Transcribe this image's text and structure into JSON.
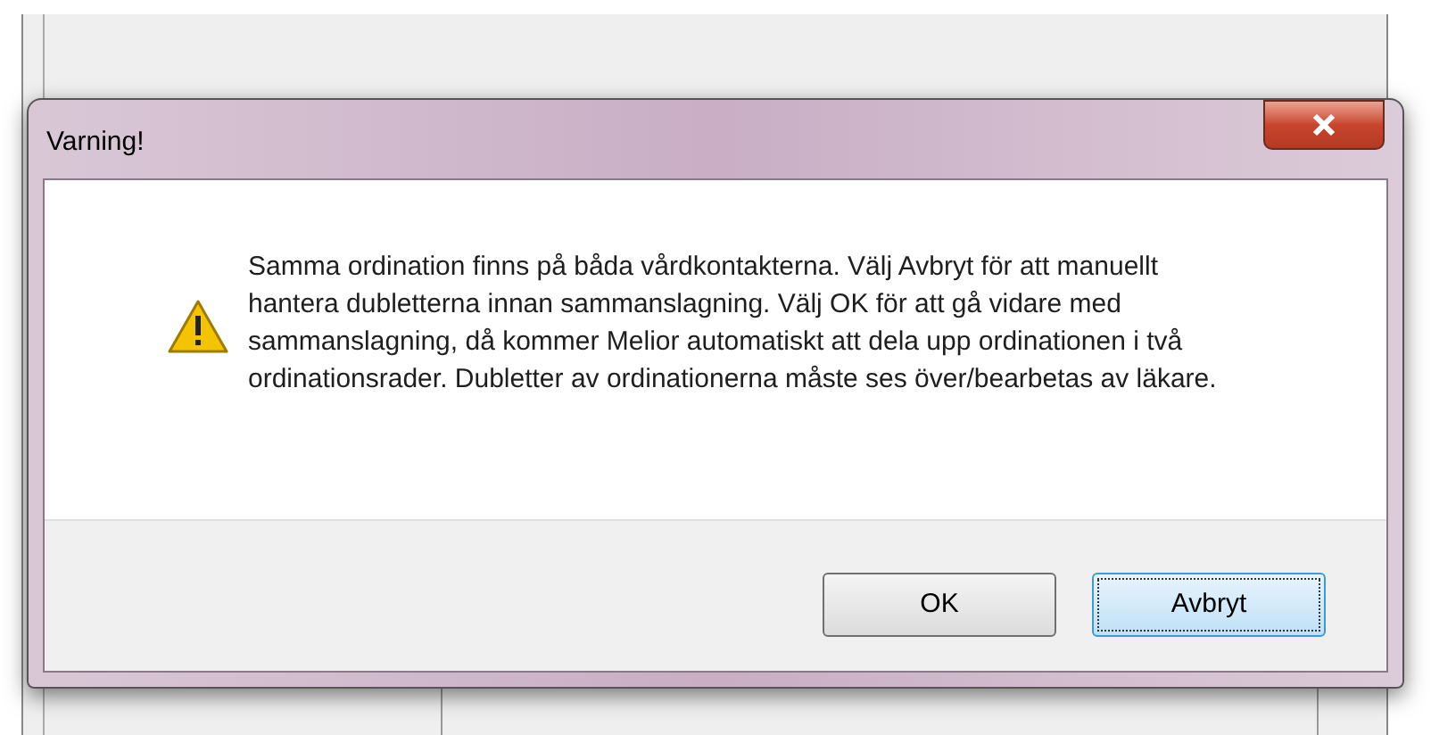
{
  "dialog": {
    "title": "Varning!",
    "message": "Samma ordination finns på båda vårdkontakterna. Välj Avbryt för att manuellt hantera dubletterna innan sammanslagning. Välj OK för att gå vidare med sammanslagning, då kommer Melior automatiskt att dela upp ordinationen i två ordinationsrader. Dubletter av ordinationerna måste ses över/bearbetas av läkare.",
    "buttons": [
      {
        "label": "OK",
        "focused": false
      },
      {
        "label": "Avbryt",
        "focused": true
      }
    ]
  }
}
